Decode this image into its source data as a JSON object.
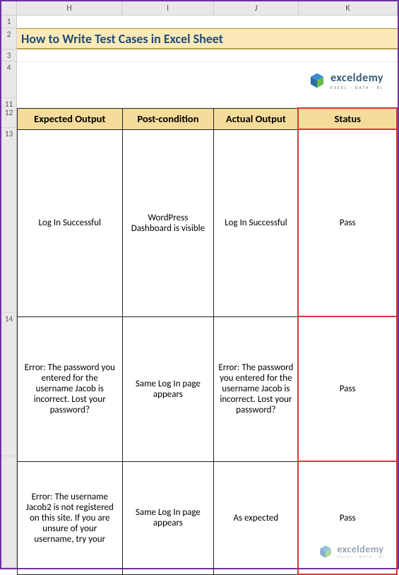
{
  "columns": {
    "H": "H",
    "I": "I",
    "J": "J",
    "K": "K"
  },
  "rows": {
    "r1": "1",
    "r2": "2",
    "r3": "3",
    "r4": "4",
    "r11": "11",
    "r12": "12",
    "r13": "13",
    "r14": "14",
    "r15": ""
  },
  "title": "How to Write Test Cases in Excel Sheet",
  "logo": {
    "main": "exceldemy",
    "sub": "EXCEL · DATA · BI"
  },
  "headers": {
    "H": "Expected Output",
    "I": "Post-condition",
    "J": "Actual Output",
    "K": "Status"
  },
  "data": [
    {
      "expected": "Log In Successful",
      "postcond": "WordPress Dashboard is visible",
      "actual": "Log In Successful",
      "status": "Pass"
    },
    {
      "expected": "Error: The password you entered for the username Jacob is incorrect. Lost your password?",
      "postcond": "Same Log In page appears",
      "actual": "Error: The password you entered for the username Jacob is incorrect. Lost your password?",
      "status": "Pass"
    },
    {
      "expected": "Error: The username Jacob2 is not registered on this site. If you are unsure of your username, try your",
      "postcond": "Same Log In page appears",
      "actual": "As expected",
      "status": "Pass"
    }
  ]
}
